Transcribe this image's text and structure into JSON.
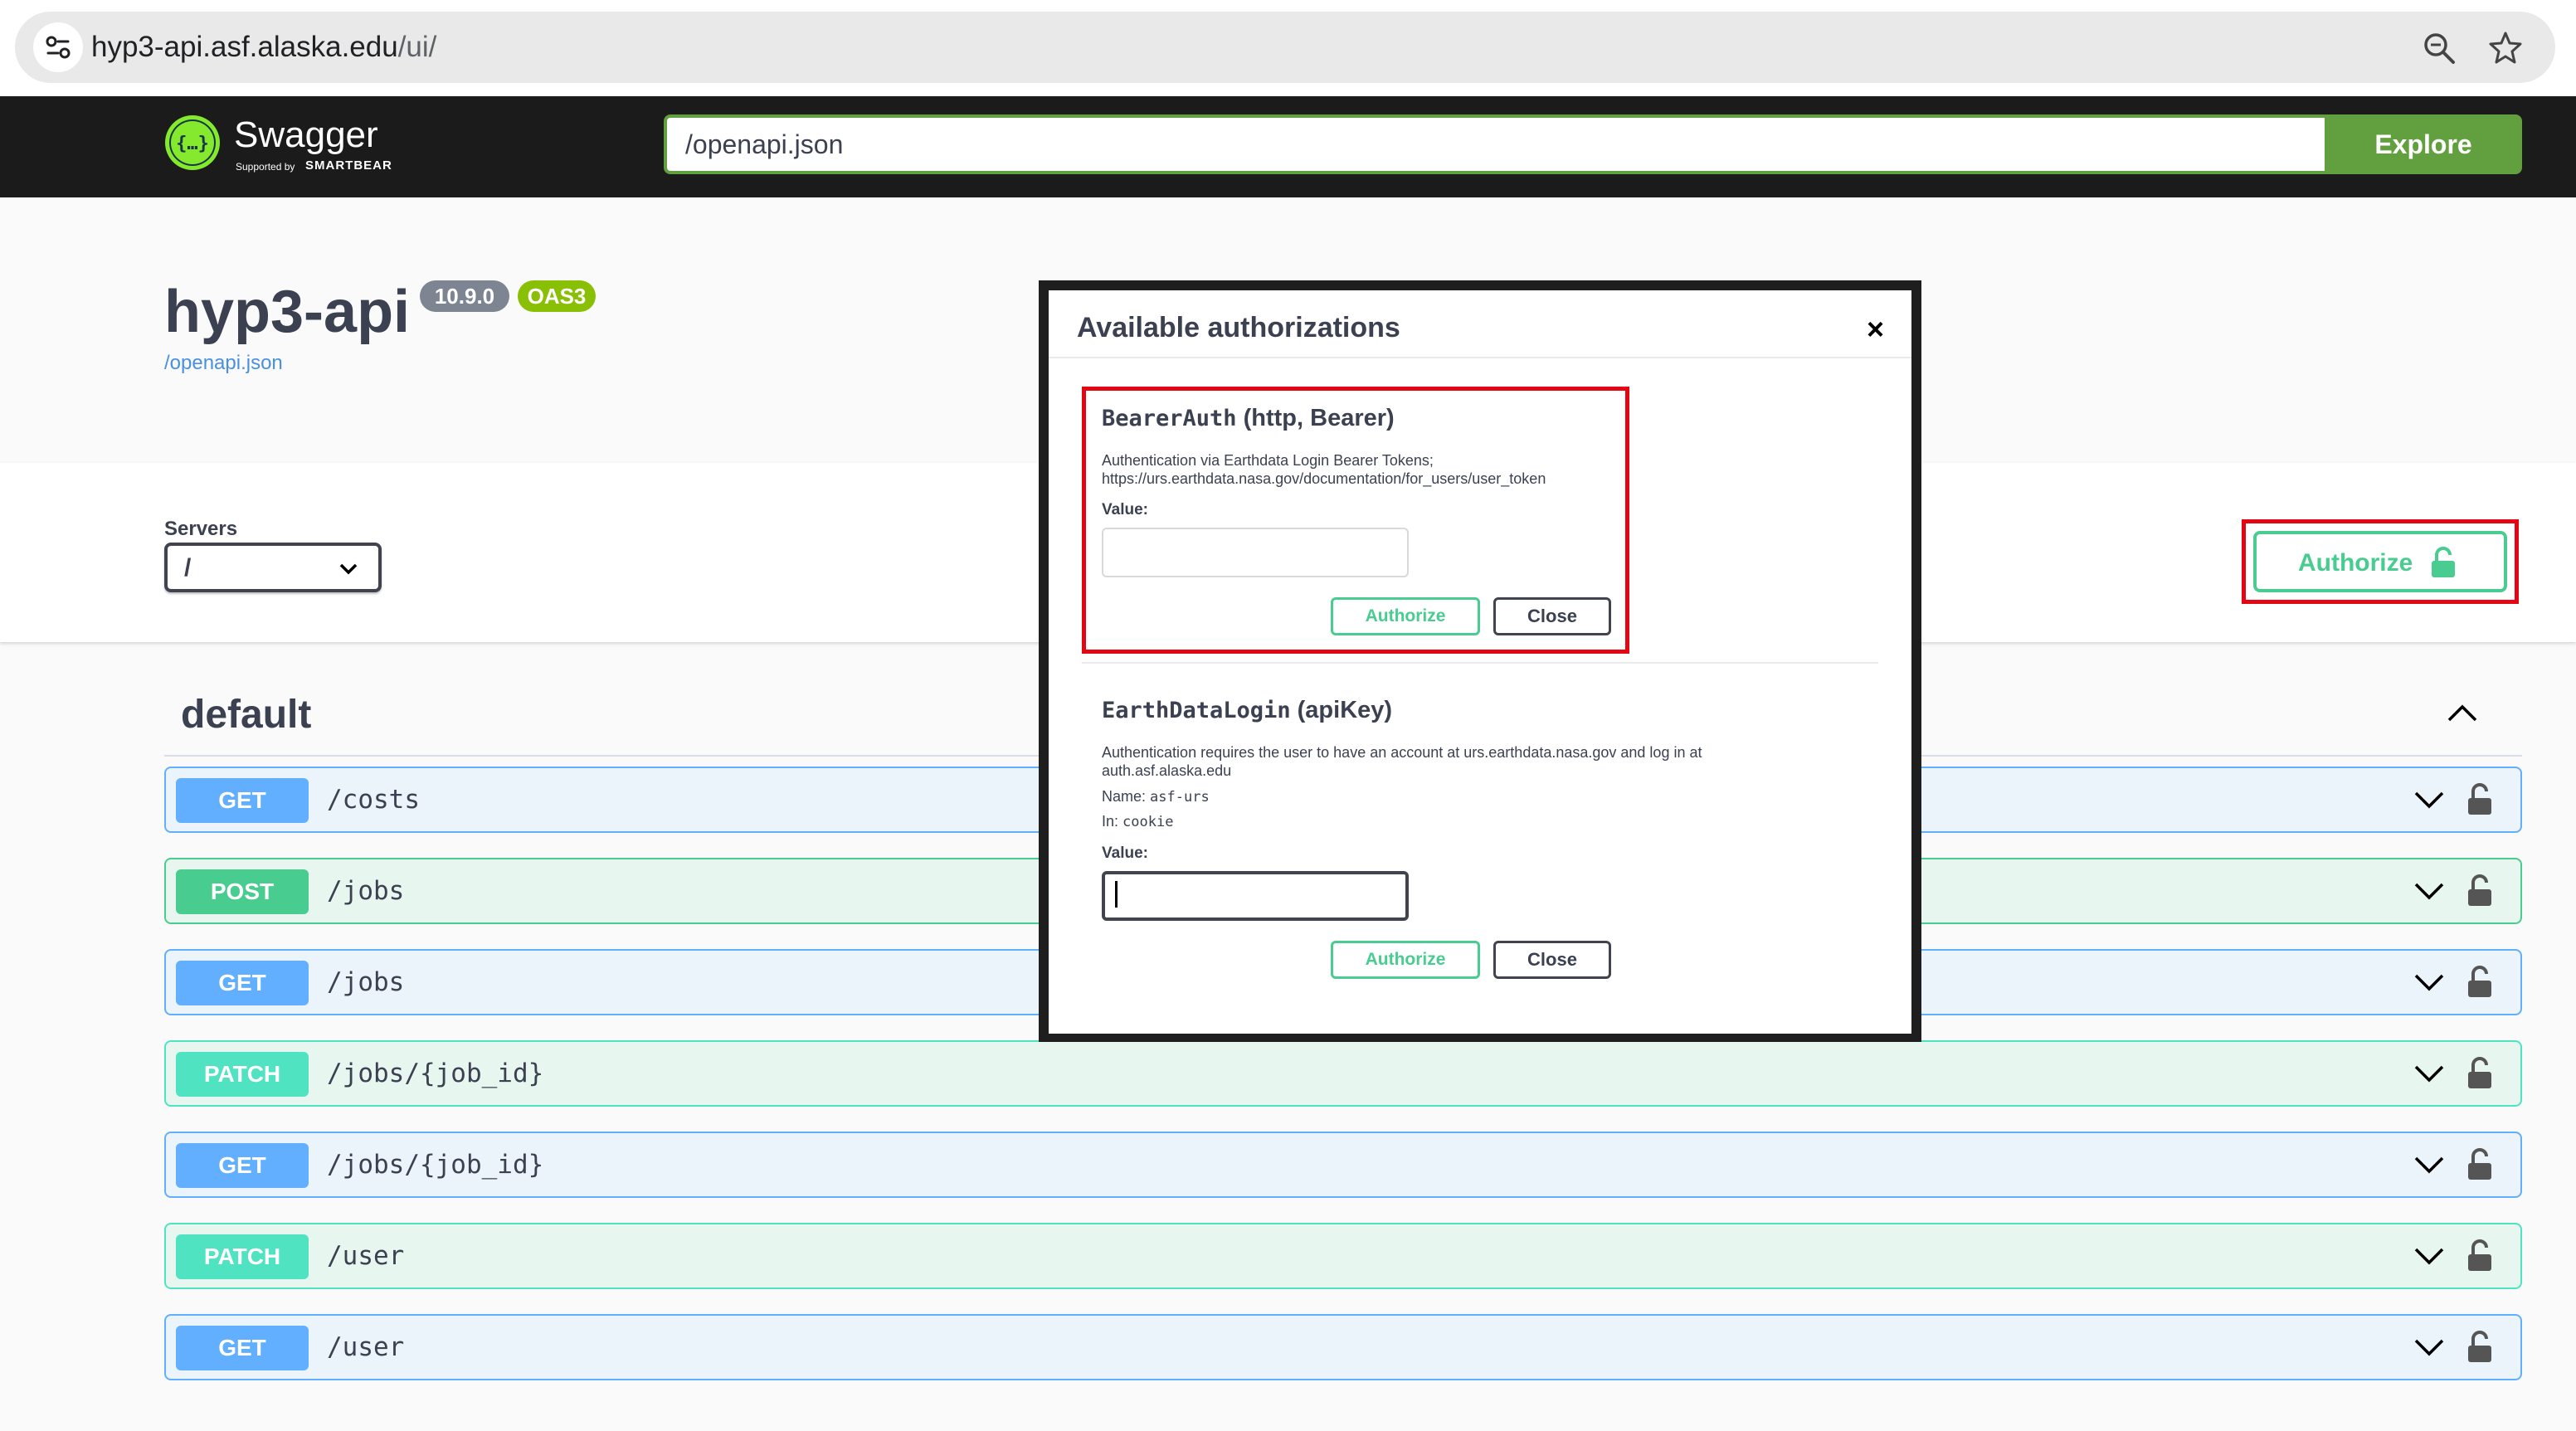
{
  "browser": {
    "url_host": "hyp3-api.asf.alaska.edu",
    "url_path": "/ui/",
    "icons": [
      "site-settings-icon",
      "zoom-icon",
      "bookmark-star-icon"
    ]
  },
  "topbar": {
    "logo_text": "Swagger",
    "logo_sub": "Supported by",
    "logo_brand": "SMARTBEAR",
    "spec_url": "/openapi.json",
    "explore_label": "Explore"
  },
  "info": {
    "title": "hyp3-api",
    "version": "10.9.0",
    "oas": "OAS3",
    "spec_link": "/openapi.json"
  },
  "schemes": {
    "servers_label": "Servers",
    "server_value": "/",
    "authorize_label": "Authorize"
  },
  "section": {
    "title": "default",
    "operations": [
      {
        "method": "GET",
        "path": "/costs"
      },
      {
        "method": "POST",
        "path": "/jobs"
      },
      {
        "method": "GET",
        "path": "/jobs"
      },
      {
        "method": "PATCH",
        "path": "/jobs/{job_id}"
      },
      {
        "method": "GET",
        "path": "/jobs/{job_id}"
      },
      {
        "method": "PATCH",
        "path": "/user"
      },
      {
        "method": "GET",
        "path": "/user"
      }
    ]
  },
  "modal": {
    "title": "Available authorizations",
    "close_symbol": "×",
    "bearer": {
      "name": "BearerAuth",
      "type": "(http, Bearer)",
      "desc_line1": "Authentication via Earthdata Login Bearer Tokens;",
      "desc_line2": "https://urs.earthdata.nasa.gov/documentation/for_users/user_token",
      "value_label": "Value:",
      "value": "",
      "authorize_label": "Authorize",
      "close_label": "Close"
    },
    "earthdata": {
      "name": "EarthDataLogin",
      "type": "(apiKey)",
      "desc_line1": "Authentication requires the user to have an account at urs.earthdata.nasa.gov and log in at",
      "desc_line2": "auth.asf.alaska.edu",
      "name_label": "Name:",
      "name_value": "asf-urs",
      "in_label": "In:",
      "in_value": "cookie",
      "value_label": "Value:",
      "value": "",
      "authorize_label": "Authorize",
      "close_label": "Close"
    }
  },
  "colors": {
    "get": "#61affe",
    "post": "#49cc90",
    "patch": "#50e3c2",
    "highlight": "#e30613",
    "topbar": "#1b1b1b",
    "explore": "#62a03f"
  }
}
